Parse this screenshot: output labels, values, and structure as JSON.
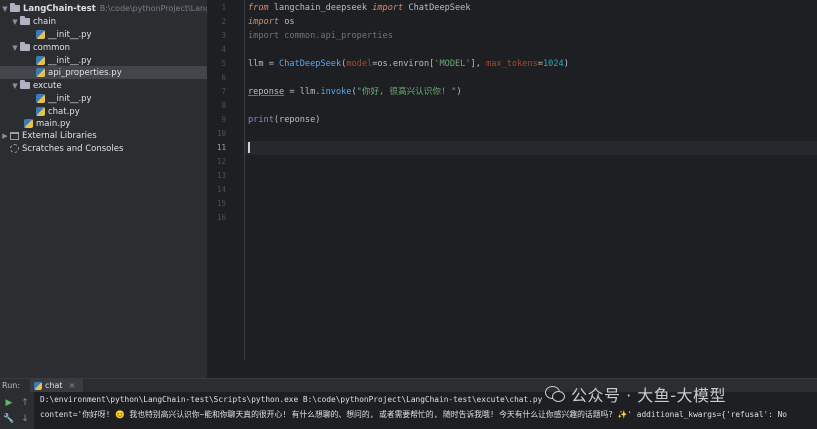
{
  "project": {
    "root": {
      "name": "LangChain-test",
      "path": "B:\\code\\pythonProject\\LangChain-test"
    },
    "items": [
      {
        "kind": "folder",
        "label": "chain"
      },
      {
        "kind": "file",
        "label": "__init__.py"
      },
      {
        "kind": "folder",
        "label": "common"
      },
      {
        "kind": "file",
        "label": "__init__.py"
      },
      {
        "kind": "file",
        "label": "api_properties.py"
      },
      {
        "kind": "folder",
        "label": "excute"
      },
      {
        "kind": "file",
        "label": "__init__.py"
      },
      {
        "kind": "file",
        "label": "chat.py"
      },
      {
        "kind": "file",
        "label": "main.py"
      },
      {
        "kind": "lib",
        "label": "External Libraries"
      },
      {
        "kind": "scratch",
        "label": "Scratches and Consoles"
      }
    ]
  },
  "editor": {
    "line_numbers": [
      "1",
      "2",
      "3",
      "4",
      "5",
      "6",
      "7",
      "8",
      "9",
      "10",
      "11",
      "12",
      "13",
      "14",
      "15",
      "16"
    ],
    "current_line": "11",
    "code": {
      "l1": {
        "from": "from",
        "module": " langchain_deepseek ",
        "import": "import",
        "name": " ChatDeepSeek"
      },
      "l2": {
        "import": "import",
        "name": " os"
      },
      "l3": {
        "text": "import common.api_properties"
      },
      "l5": {
        "var": "llm = ",
        "cls": "ChatDeepSeek",
        "open": "(",
        "p1": "model",
        "eq1": "=os.environ[",
        "s1": "'MODEL'",
        "mid": "], ",
        "p2": "max_tokens",
        "eq2": "=",
        "n": "1024",
        "close": ")"
      },
      "l7": {
        "var": "reponse",
        "assign": " = llm.",
        "method": "invoke",
        "open": "(",
        "s": "\"你好, 很高兴认识你! \"",
        "close": ")"
      },
      "l9": {
        "fn": "print",
        "args": "(reponse)"
      }
    }
  },
  "run": {
    "label": "Run:",
    "tab": "chat",
    "command": "D:\\environment\\python\\LangChain-test\\Scripts\\python.exe B:\\code\\pythonProject\\LangChain-test\\excute\\chat.py",
    "output": "content='你好呀! 😊 我也特别高兴认识你~能和你聊天真的很开心! 有什么想聊的、想问的, 或者需要帮忙的, 随时告诉我哦! 今天有什么让你感兴趣的话题吗? ✨' additional_kwargs={'refusal': No"
  },
  "watermark": {
    "text": "公众号 · 大鱼-大模型"
  },
  "colors": {
    "background": "#1e1f22",
    "panel": "#2b2d30",
    "keyword": "#cf8e6d",
    "string": "#6aab73",
    "function": "#56a8f5",
    "param": "#aa4926",
    "number": "#2aacb8"
  }
}
